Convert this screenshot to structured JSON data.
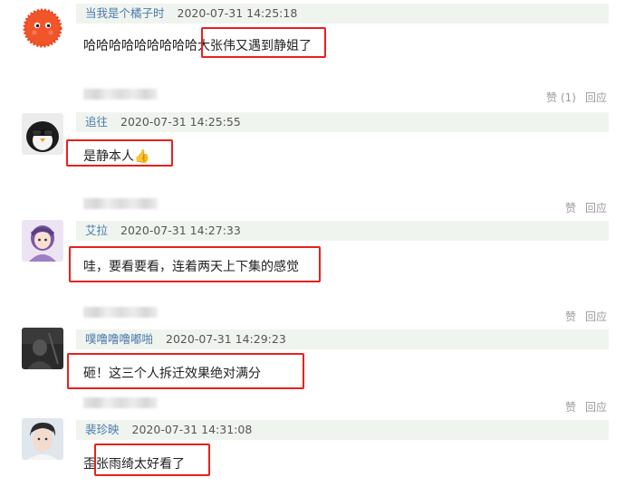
{
  "comments": [
    {
      "username": "当我是个橘子时",
      "timestamp": "2020-07-31 14:25:18",
      "text_prefix": "哈哈哈哈哈哈哈哈哈",
      "text_highlight": "大张伟又遇到静姐了",
      "avatar": "orange-fuzzy-ball",
      "actions": {
        "like": "赞",
        "like_count": "(1)",
        "reply": "回应"
      }
    },
    {
      "username": "追往",
      "timestamp": "2020-07-31 14:25:55",
      "text_highlight": "是静本人👍",
      "avatar": "penguin-with-sunglasses",
      "actions": {
        "like": "赞",
        "reply": "回应"
      }
    },
    {
      "username": "艾拉",
      "timestamp": "2020-07-31 14:27:33",
      "text_highlight": "哇，要看要看，连着两天上下集的感觉",
      "avatar": "anime-girl-purple",
      "actions": {
        "like": "赞",
        "reply": "回应"
      }
    },
    {
      "username": "噗噜噜噜嘟啪",
      "timestamp": "2020-07-31 14:29:23",
      "text_highlight": "砸！这三个人拆迁效果绝对满分",
      "avatar": "dark-figure",
      "actions": {
        "like": "赞",
        "reply": "回应"
      }
    },
    {
      "username": "裴珍映",
      "timestamp": "2020-07-31 14:31:08",
      "text_prefix": "歪",
      "text_highlight": "张雨绮太好看了",
      "avatar": "young-man-portrait",
      "actions": null
    }
  ],
  "colors": {
    "header_bg": "#f0f4ef",
    "username": "#4a7bab",
    "highlight": "#e8201d"
  }
}
